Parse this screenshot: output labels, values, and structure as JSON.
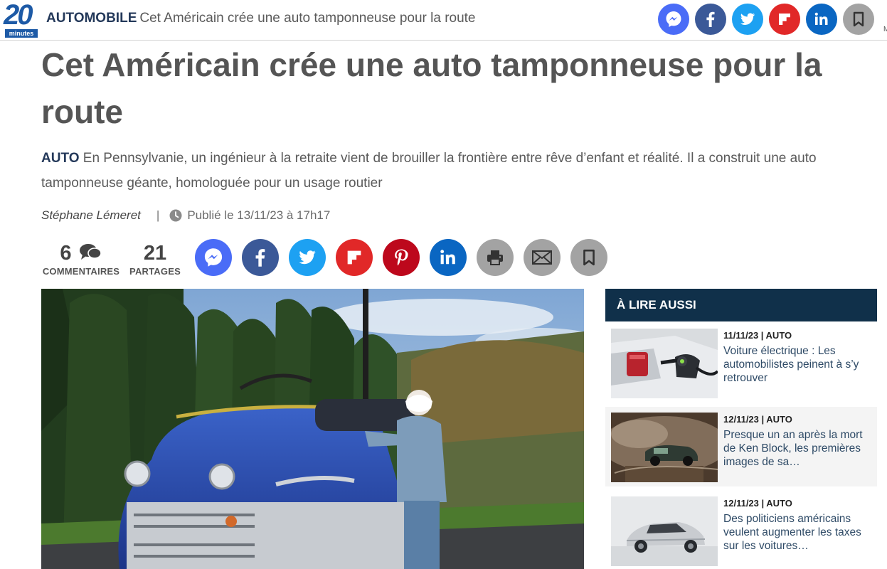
{
  "logo": {
    "number": "20",
    "subtitle": "minutes"
  },
  "header": {
    "category": "AUTOMOBILE",
    "title": "Cet Américain crée une auto tamponneuse pour la route",
    "share_icons": [
      "messenger-icon",
      "facebook-icon",
      "twitter-icon",
      "flipboard-icon",
      "linkedin-icon",
      "bookmark-icon"
    ],
    "edge_mark": "M"
  },
  "article": {
    "headline": "Cet Américain crée une auto tamponneuse pour la route",
    "chapo_tag": "AUTO",
    "chapo": "En Pennsylvanie, un ingénieur à la retraite vient de brouiller la frontière entre rêve d’enfant et réalité. Il a construit une auto tamponneuse géante, homologuée pour un usage routier",
    "author": "Stéphane Lémeret",
    "separator": "|",
    "published": "Publié le 13/11/23 à 17h17",
    "comments_count": "6",
    "comments_label": "COMMENTAIRES",
    "shares_count": "21",
    "shares_label": "PARTAGES",
    "share_icons": [
      "messenger-icon",
      "facebook-icon",
      "twitter-icon",
      "flipboard-icon",
      "pinterest-icon",
      "linkedin-icon",
      "print-icon",
      "email-icon",
      "bookmark-icon"
    ]
  },
  "aside": {
    "heading": "À LIRE AUSSI",
    "items": [
      {
        "meta": "11/11/23 | AUTO",
        "title": "Voiture électrique : Les automobilistes peinent à s’y retrouver"
      },
      {
        "meta": "12/11/23 | AUTO",
        "title": "Presque un an après la mort de Ken Block, les premières images de sa…"
      },
      {
        "meta": "12/11/23 | AUTO",
        "title": "Des politiciens américains veulent augmenter les taxes sur les voitures…"
      }
    ]
  },
  "colors": {
    "brand_blue": "#1d5aa6",
    "navy": "#24395a",
    "aside_head": "#10304a",
    "messenger": "#4a6cf7",
    "facebook": "#3b5998",
    "twitter": "#1da1f2",
    "flipboard": "#e12828",
    "pinterest": "#bd081c",
    "linkedin": "#0a66c2",
    "gray_icon": "#9b9b9b"
  }
}
